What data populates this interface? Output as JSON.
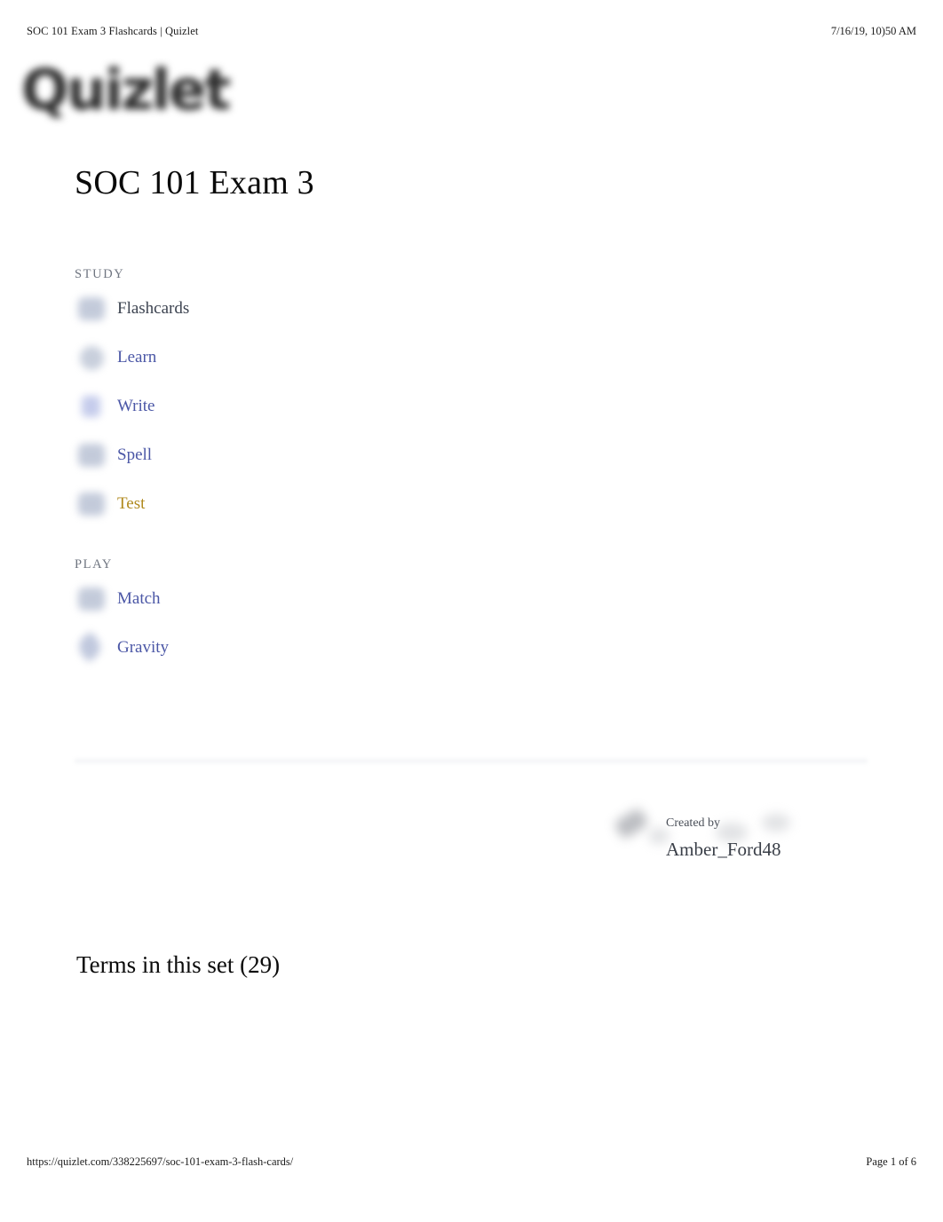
{
  "print_header": {
    "title": "SOC 101 Exam 3 Flashcards | Quizlet",
    "date": "7/16/19, 10)50 AM"
  },
  "brand": {
    "logo_text": "Quizlet"
  },
  "set": {
    "title": "SOC 101 Exam 3",
    "terms_heading": "Terms in this set (29)"
  },
  "study_section": {
    "label": "STUDY",
    "items": [
      {
        "label": "Flashcards",
        "icon": "flashcards-icon",
        "state": "current"
      },
      {
        "label": "Learn",
        "icon": "learn-icon",
        "state": "link"
      },
      {
        "label": "Write",
        "icon": "write-icon",
        "state": "link"
      },
      {
        "label": "Spell",
        "icon": "spell-icon",
        "state": "link"
      },
      {
        "label": "Test",
        "icon": "test-icon",
        "state": "accent"
      }
    ]
  },
  "play_section": {
    "label": "PLAY",
    "items": [
      {
        "label": "Match",
        "icon": "match-icon",
        "state": "link"
      },
      {
        "label": "Gravity",
        "icon": "gravity-icon",
        "state": "link"
      }
    ]
  },
  "creator": {
    "label": "Created by",
    "username": "Amber_Ford48"
  },
  "print_footer": {
    "url": "https://quizlet.com/338225697/soc-101-exam-3-flash-cards/",
    "page": "Page 1 of 6"
  },
  "colors": {
    "link": "#4b57a6",
    "accent": "#b08a1e",
    "current": "#3d4451",
    "muted": "#6f7580",
    "text": "#0a0a0a"
  }
}
